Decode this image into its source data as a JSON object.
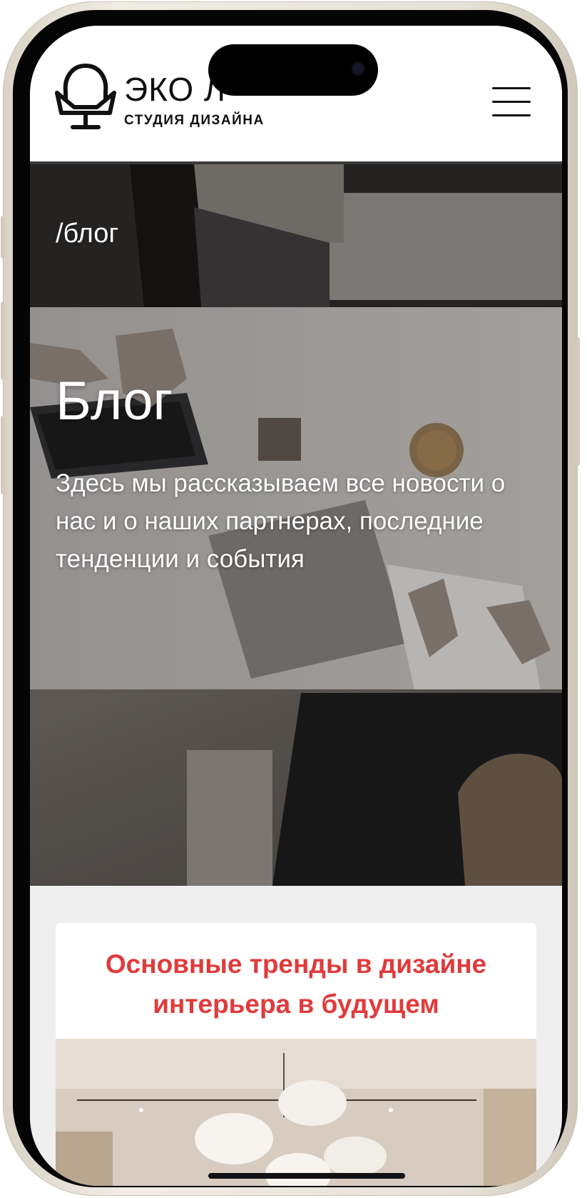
{
  "header": {
    "brand_name": "ЭКО Л",
    "brand_subtitle": "СТУДИЯ ДИЗАЙНА",
    "logo_icon": "armchair-icon",
    "menu_icon": "hamburger-menu-icon"
  },
  "hero": {
    "breadcrumb": "/блог",
    "title": "Блог",
    "description": "Здесь мы рассказываем все новости о нас и о наших партнерах, последние тенденции и события"
  },
  "posts": [
    {
      "title": "Основные тренды в дизайне интерьера в будущем"
    }
  ],
  "colors": {
    "accent": "#e03b3b",
    "header_bg": "#ffffff",
    "page_bg": "#efefef",
    "text_dark": "#111111"
  }
}
